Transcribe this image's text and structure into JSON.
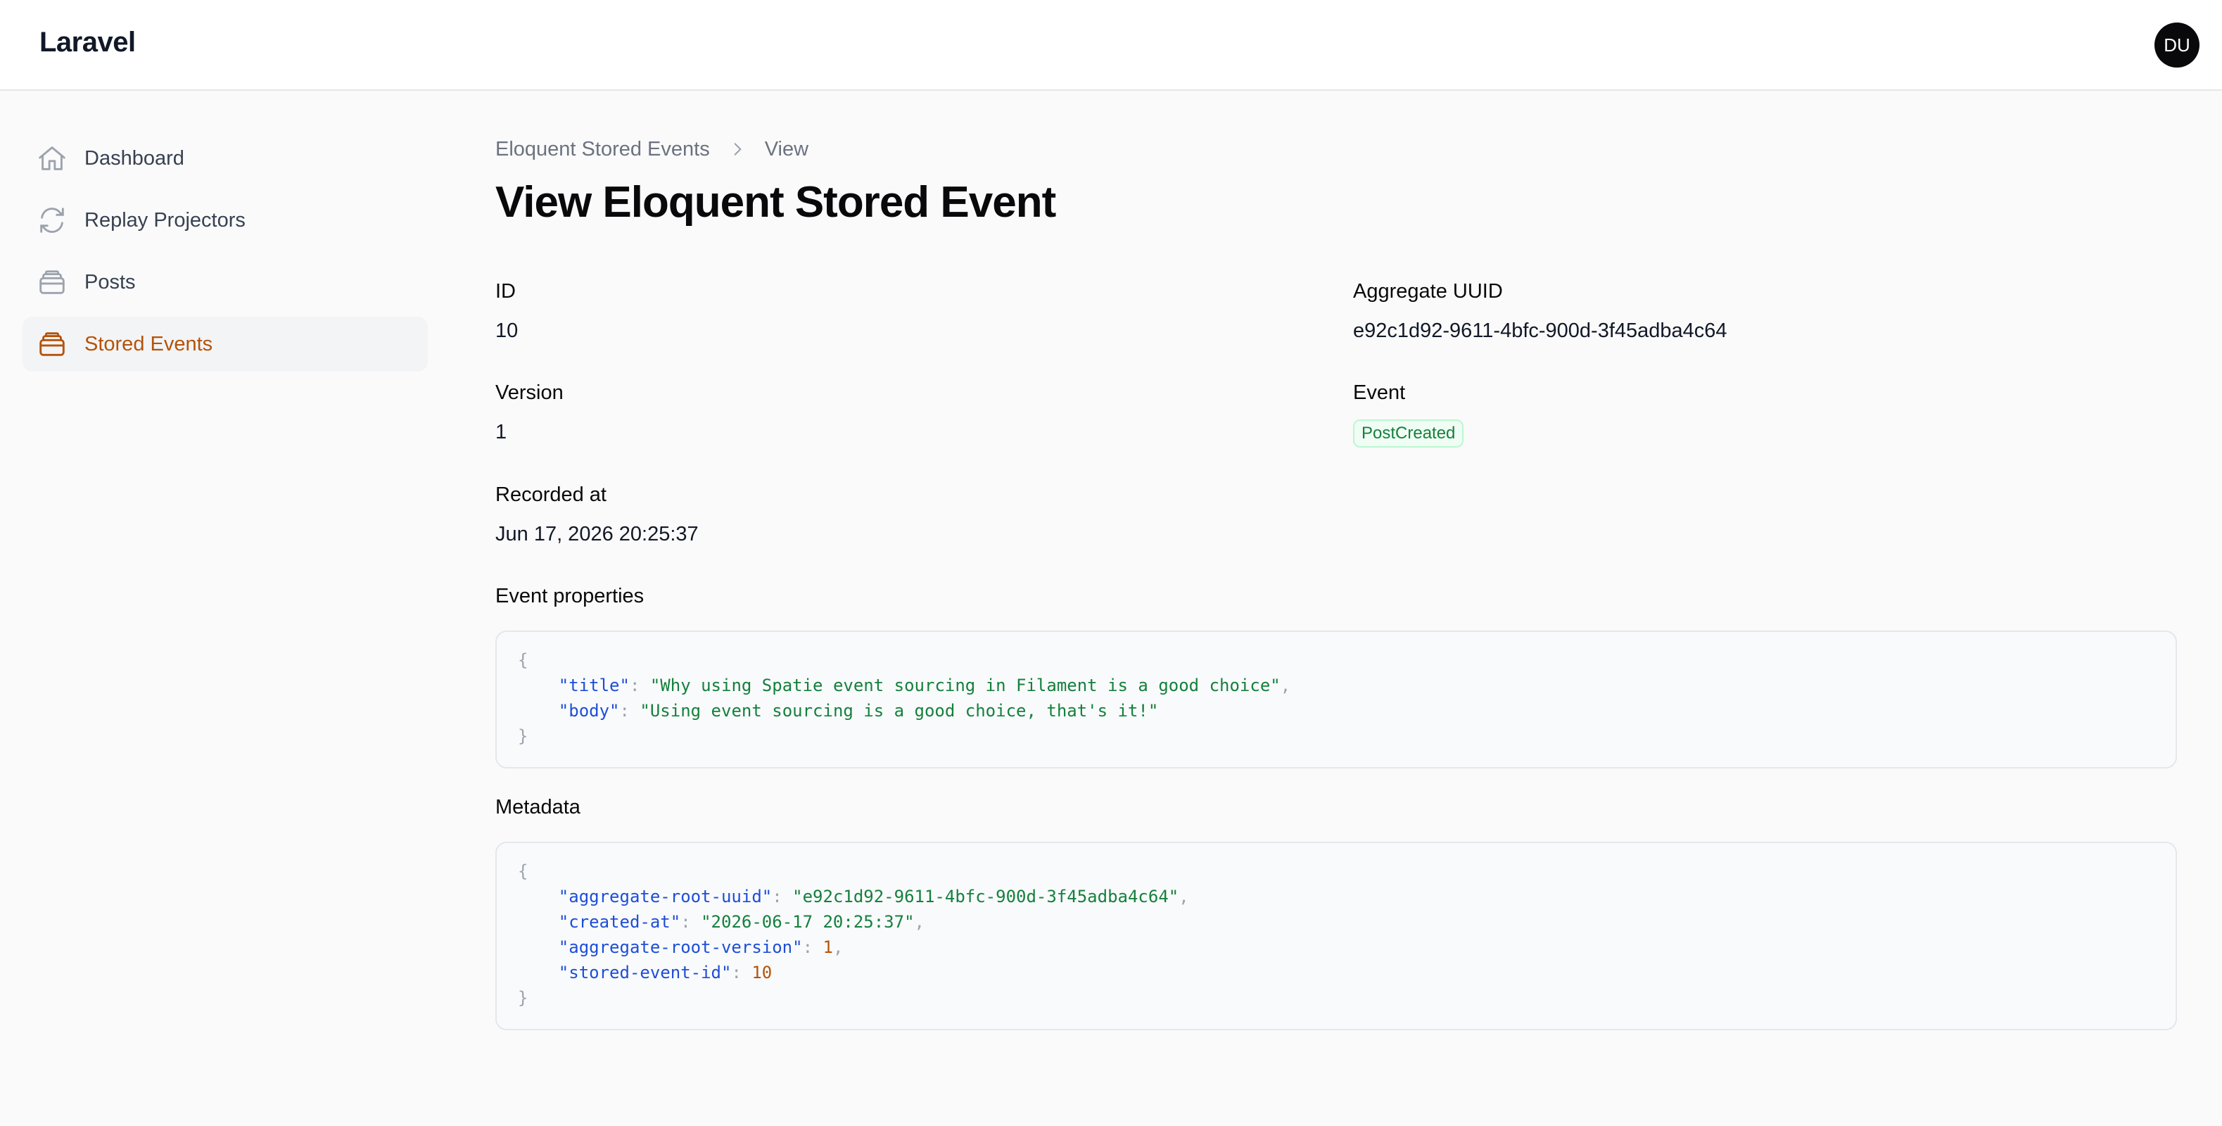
{
  "app": {
    "brand": "Laravel",
    "avatar_initials": "DU"
  },
  "sidebar": {
    "items": [
      {
        "label": "Dashboard",
        "icon": "home-icon",
        "active": false
      },
      {
        "label": "Replay Projectors",
        "icon": "refresh-icon",
        "active": false
      },
      {
        "label": "Posts",
        "icon": "stack-icon",
        "active": false
      },
      {
        "label": "Stored Events",
        "icon": "stack-icon",
        "active": true
      }
    ]
  },
  "breadcrumb": {
    "parent": "Eloquent Stored Events",
    "current": "View"
  },
  "page": {
    "title": "View Eloquent Stored Event"
  },
  "fields": {
    "id": {
      "label": "ID",
      "value": "10"
    },
    "aggregate_uuid": {
      "label": "Aggregate UUID",
      "value": "e92c1d92-9611-4bfc-900d-3f45adba4c64"
    },
    "version": {
      "label": "Version",
      "value": "1"
    },
    "event": {
      "label": "Event",
      "value": "PostCreated"
    },
    "recorded_at": {
      "label": "Recorded at",
      "value": "Jun 17, 2026 20:25:37"
    }
  },
  "event_properties": {
    "label": "Event properties",
    "entries": [
      {
        "key": "\"title\"",
        "value": "\"Why using Spatie event sourcing in Filament is a good choice\"",
        "type": "string",
        "comma": ","
      },
      {
        "key": "\"body\"",
        "value": "\"Using event sourcing is a good choice, that's it!\"",
        "type": "string",
        "comma": ""
      }
    ]
  },
  "metadata": {
    "label": "Metadata",
    "entries": [
      {
        "key": "\"aggregate-root-uuid\"",
        "value": "\"e92c1d92-9611-4bfc-900d-3f45adba4c64\"",
        "type": "string",
        "comma": ","
      },
      {
        "key": "\"created-at\"",
        "value": "\"2026-06-17 20:25:37\"",
        "type": "string",
        "comma": ","
      },
      {
        "key": "\"aggregate-root-version\"",
        "value": "1",
        "type": "number",
        "comma": ","
      },
      {
        "key": "\"stored-event-id\"",
        "value": "10",
        "type": "number",
        "comma": ""
      }
    ]
  },
  "code": {
    "open": "{",
    "close": "}",
    "colon": ": ",
    "indent": "    "
  },
  "colors": {
    "accent": "#b45309",
    "badge_green": "#15803d",
    "json_key": "#1d4ed8",
    "json_string": "#15803d",
    "json_number": "#b45309"
  }
}
